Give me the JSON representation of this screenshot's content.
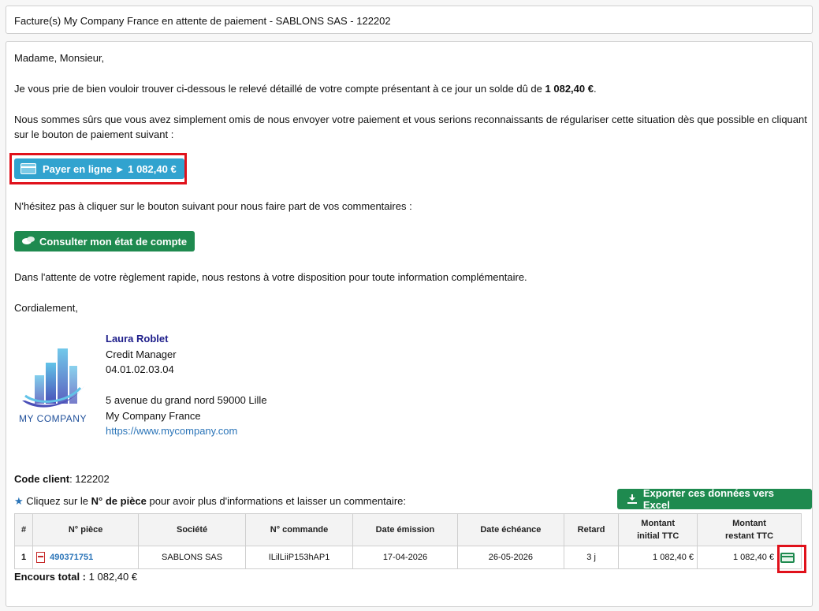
{
  "email": {
    "subject": "Facture(s) My Company France en attente de paiement - SABLONS SAS - 122202",
    "greeting": "Madame, Monsieur,",
    "intro_text": "Je vous prie de bien vouloir trouver ci-dessous le relevé détaillé de votre compte présentant à ce jour un solde dû de",
    "balance": "1 082,40 €",
    "reminder_line1": "Nous sommes sûrs que vous avez simplement omis de nous envoyer votre paiement et vous serions reconnaissants de régulariser cette situation dès que possible en cliquant",
    "reminder_line2": "sur le bouton de paiement suivant :",
    "pay_button": "Payer en ligne ► 1 082,40 €",
    "comment_prompt": "N'hésitez pas à cliquer sur le bouton suivant pour nous faire part de vos commentaires :",
    "account_button": "Consulter mon état de compte",
    "closing_text": "Dans l'attente de votre règlement rapide, nous restons à votre disposition pour toute information complémentaire.",
    "sign_off": "Cordialement,"
  },
  "signature": {
    "name": "Laura Roblet",
    "role": "Credit Manager",
    "phone": "04.01.02.03.04",
    "address": "5 avenue du grand nord 59000 Lille",
    "company": "My Company France",
    "website": "https://www.mycompany.com",
    "logo_text": "MY COMPANY"
  },
  "client": {
    "code_label": "Code client",
    "code_value": ": 122202",
    "hint_pre": "Cliquez sur le",
    "hint_bold": "N° de pièce",
    "hint_post": "pour avoir plus d'informations et laisser un commentaire:",
    "export_button": "Exporter ces données vers Excel"
  },
  "table": {
    "headers": [
      "#",
      "N° pièce",
      "Société",
      "N° commande",
      "Date émission",
      "Date échéance",
      "Retard",
      "Montant initial TTC",
      "Montant restant TTC"
    ],
    "rows": [
      {
        "index": "1",
        "piece": "490371751",
        "societe": "SABLONS SAS",
        "commande": "ILilLiiP153hAP1",
        "emission": "17-04-2026",
        "echeance": "26-05-2026",
        "retard": "3 j",
        "initial": "1 082,40 €",
        "restant": "1 082,40 €"
      }
    ]
  },
  "total": {
    "label": "Encours total :",
    "value": "1 082,40 €"
  },
  "colors": {
    "pay_button": "#31a3cf",
    "green_button": "#1e8a4f",
    "highlight": "#e0111b",
    "link": "#2a74b8"
  }
}
